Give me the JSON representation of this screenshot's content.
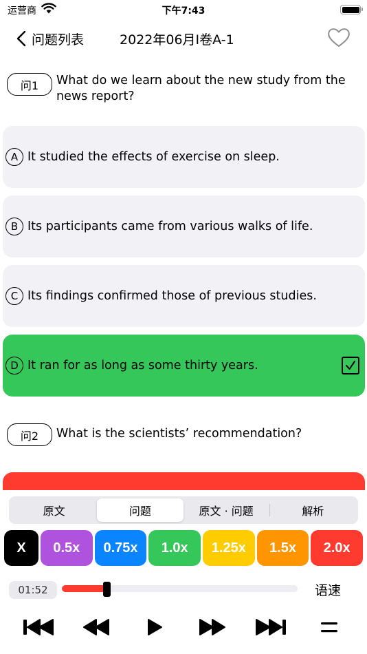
{
  "status_bar": {
    "carrier": "运营商",
    "time": "下午7:43"
  },
  "nav": {
    "back_label": "问题列表",
    "title": "2022年06月I卷A-1"
  },
  "questions": [
    {
      "badge": "问1",
      "text": "What do we learn about the new study from the news report?",
      "options": [
        {
          "letter": "A",
          "text": "It studied the effects of exercise on sleep."
        },
        {
          "letter": "B",
          "text": "Its participants came from various walks of life."
        },
        {
          "letter": "C",
          "text": "Its findings confirmed those of previous studies."
        },
        {
          "letter": "D",
          "text": "It ran for as long as some thirty years.",
          "selected": true
        }
      ]
    },
    {
      "badge": "问2",
      "text": "What is the scientists’ recommendation?"
    }
  ],
  "tabs": [
    "原文",
    "问题",
    "原文 · 问题",
    "解析"
  ],
  "active_tab": "问题",
  "speeds": [
    {
      "label": "X",
      "color": "#000000"
    },
    {
      "label": "0.5x",
      "color": "#af52de"
    },
    {
      "label": "0.75x",
      "color": "#0a84ff"
    },
    {
      "label": "1.0x",
      "color": "#35c759"
    },
    {
      "label": "1.25x",
      "color": "#ffcc00"
    },
    {
      "label": "1.5x",
      "color": "#ff9500"
    },
    {
      "label": "2.0x",
      "color": "#ff3b30"
    }
  ],
  "player": {
    "elapsed": "01:52",
    "progress": 0.19,
    "rate_label": "语速"
  },
  "colors": {
    "selected_option": "#35c759",
    "accent_red": "#ff3b30"
  }
}
